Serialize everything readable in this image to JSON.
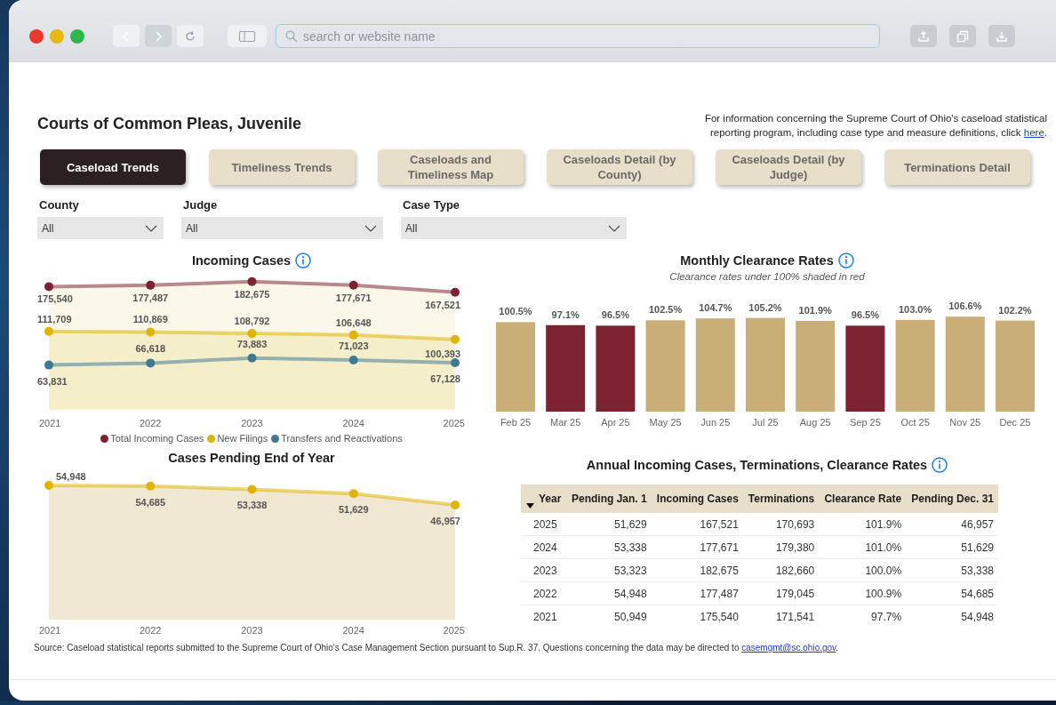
{
  "browser": {
    "address_placeholder": "search or website name"
  },
  "header": {
    "title": "Courts of Common Pleas, Juvenile",
    "info_text": "For information concerning the Supreme Court of Ohio's caseload statistical reporting program, including case type and measure definitions, click",
    "info_link": "here",
    "info_end": "."
  },
  "tabs": [
    {
      "label": "Caseload Trends",
      "selected": true
    },
    {
      "label": "Timeliness Trends",
      "selected": false
    },
    {
      "label": "Caseloads and Timeliness Map",
      "selected": false
    },
    {
      "label": "Caseloads Detail (by County)",
      "selected": false
    },
    {
      "label": "Caseloads Detail (by Judge)",
      "selected": false
    },
    {
      "label": "Terminations Detail",
      "selected": false
    }
  ],
  "filters": [
    {
      "label": "County",
      "value": "All"
    },
    {
      "label": "Judge",
      "value": "All"
    },
    {
      "label": "Case Type",
      "value": "All"
    }
  ],
  "incoming_cases": {
    "title": "Incoming Cases",
    "chart_data": {
      "type": "line",
      "x": [
        "2021",
        "2022",
        "2023",
        "2024",
        "2025"
      ],
      "series": [
        {
          "name": "Total Incoming Cases",
          "color": "#7d2230",
          "marker": "circle",
          "values": [
            175540,
            177487,
            182675,
            177671,
            167521
          ],
          "value_labels": [
            "175,540",
            "177,487",
            "182,675",
            "177,671",
            "167,521"
          ]
        },
        {
          "name": "New Filings",
          "color": "#e0b400",
          "marker": "circle",
          "values": [
            111709,
            110869,
            108792,
            106648,
            100393
          ],
          "value_labels": [
            "111,709",
            "110,869",
            "108,792",
            "106,648",
            "100,393"
          ]
        },
        {
          "name": "Transfers and Reactivations",
          "color": "#3f7a94",
          "marker": "circle",
          "values": [
            63831,
            66618,
            73883,
            71023,
            67128
          ],
          "value_labels": [
            "63,831",
            "66,618",
            "73,883",
            "71,023",
            "67,128"
          ]
        }
      ]
    }
  },
  "pending_cases": {
    "title": "Cases Pending End of Year",
    "chart_data": {
      "type": "line",
      "x": [
        "2021",
        "2022",
        "2023",
        "2024",
        "2025"
      ],
      "series": [
        {
          "color": "#e0b400",
          "marker": "circle",
          "values": [
            54948,
            54685,
            53338,
            51629,
            46957
          ],
          "value_labels": [
            "54,948",
            "54,685",
            "53,338",
            "51,629",
            "46,957"
          ]
        }
      ]
    }
  },
  "clearance_rates": {
    "title": "Monthly Clearance Rates",
    "subtitle": "Clearance rates under 100% shaded in red",
    "chart_data": {
      "type": "bar",
      "categories": [
        "Feb 25",
        "Mar 25",
        "Apr 25",
        "May 25",
        "Jun 25",
        "Jul 25",
        "Aug 25",
        "Sep 25",
        "Oct 25",
        "Nov 25",
        "Dec 25"
      ],
      "series": [
        {
          "color": "#c9ae78",
          "values": [
            100.5,
            null,
            null,
            102.5,
            104.7,
            105.2,
            101.9,
            null,
            103.0,
            106.6,
            102.2
          ],
          "value_labels": [
            "100.5%",
            null,
            null,
            "102.5%",
            "104.7%",
            "105.2%",
            "101.9%",
            null,
            "103.0%",
            "106.6%",
            "102.2%"
          ]
        },
        {
          "color": "#7d2230",
          "values": [
            null,
            97.1,
            96.5,
            null,
            null,
            null,
            null,
            96.5,
            null,
            null,
            null
          ],
          "value_labels": [
            null,
            "97.1%",
            "96.5%",
            null,
            null,
            null,
            null,
            "96.5%",
            null,
            null,
            null
          ]
        }
      ]
    }
  },
  "annual_table": {
    "title": "Annual Incoming Cases, Terminations, Clearance Rates",
    "columns": [
      {
        "label": "Year",
        "sorted": true
      },
      {
        "label": "Pending Jan. 1",
        "sorted": false
      },
      {
        "label": "Incoming Cases",
        "sorted": false
      },
      {
        "label": "Terminations",
        "sorted": false
      },
      {
        "label": "Clearance Rate",
        "sorted": false
      },
      {
        "label": "Pending Dec. 31",
        "sorted": false
      }
    ],
    "rows": [
      [
        "2025",
        "51,629",
        "167,521",
        "170,693",
        "101.9%",
        "46,957"
      ],
      [
        "2024",
        "53,338",
        "177,671",
        "179,380",
        "101.0%",
        "51,629"
      ],
      [
        "2023",
        "53,323",
        "182,675",
        "182,660",
        "100.0%",
        "53,338"
      ],
      [
        "2022",
        "54,948",
        "177,487",
        "179,045",
        "100.9%",
        "54,685"
      ],
      [
        "2021",
        "50,949",
        "175,540",
        "171,541",
        "97.7%",
        "54,948"
      ]
    ]
  },
  "footer": {
    "text": "Source: Caseload statistical reports submitted to the Supreme Court of Ohio's Case Management Section pursuant to Sup.R. 37. Questions concerning the data may be directed to",
    "link": "casemgmt@sc.ohio.gov",
    "end": "."
  }
}
